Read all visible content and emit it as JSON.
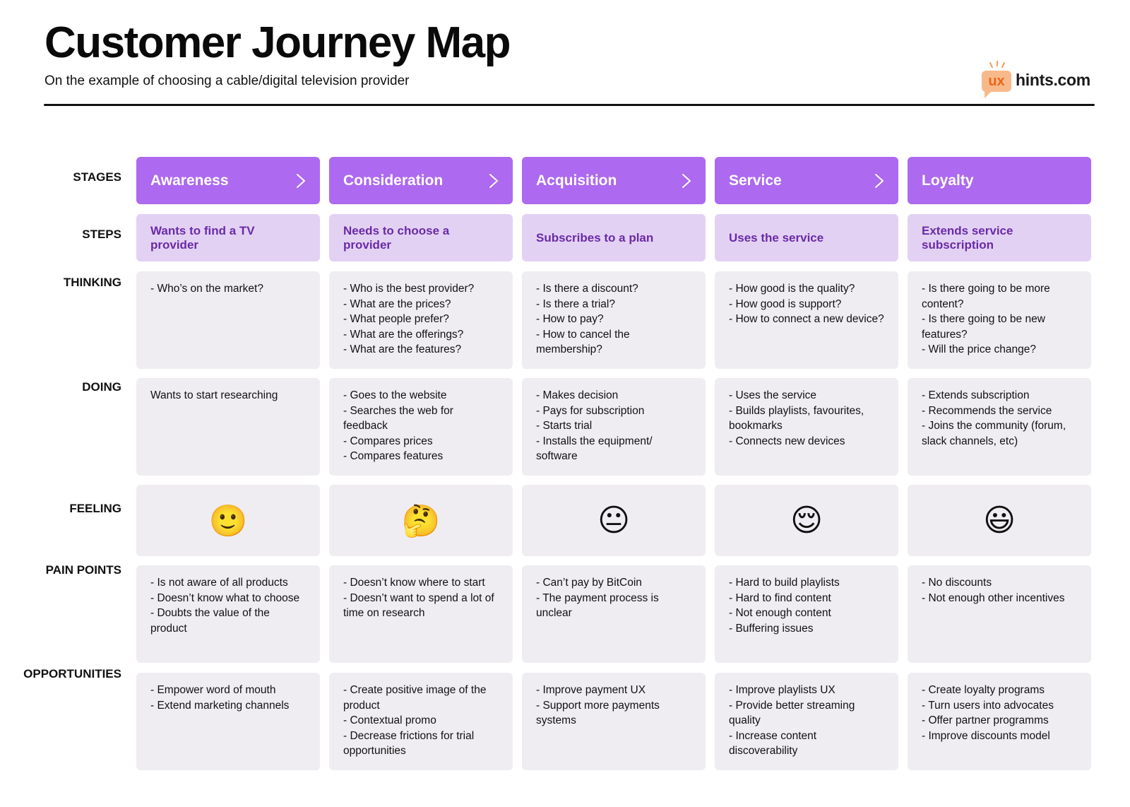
{
  "header": {
    "title": "Customer Journey Map",
    "subtitle": "On the example of choosing a cable/digital television provider"
  },
  "logo": {
    "badge": "ux",
    "text": "hints.com",
    "colors": {
      "badge_bg": "#f8b98a",
      "badge_text": "#e8671c"
    }
  },
  "row_labels": {
    "stages": "STAGES",
    "steps": "STEPS",
    "thinking": "THINKING",
    "doing": "DOING",
    "feeling": "FEELING",
    "pain_points": "PAIN POINTS",
    "opportunities": "OPPORTUNITIES"
  },
  "colors": {
    "stage_bg": "#ad69ef",
    "step_bg": "#e3d1f4",
    "step_text": "#6a2aa6",
    "card_bg": "#efedf2"
  },
  "columns": [
    {
      "stage": "Awareness",
      "has_chevron": true,
      "step": "Wants to find a TV provider",
      "thinking": "- Who’s on the market?",
      "doing": "Wants to start researching",
      "feeling": {
        "icon": "slightly-smiling-face-icon",
        "glyph": "🙂"
      },
      "pain_points": "- Is not aware of all products\n- Doesn’t know what to choose\n- Doubts the value of the product",
      "opportunities": "- Empower word of mouth\n- Extend marketing channels"
    },
    {
      "stage": "Consideration",
      "has_chevron": true,
      "step": "Needs to choose a provider",
      "thinking": "- Who is the best provider?\n- What are the prices?\n- What people prefer?\n- What are the offerings?\n- What are the features?",
      "doing": "- Goes to the website\n- Searches the web for feedback\n- Compares prices\n- Compares features",
      "feeling": {
        "icon": "thinking-face-icon",
        "glyph": "🤔"
      },
      "pain_points": "- Doesn’t know where to start\n- Doesn’t want to spend a lot of time on research",
      "opportunities": "- Create positive image of the product\n- Contextual promo\n- Decrease frictions for trial opportunities"
    },
    {
      "stage": "Acquisition",
      "has_chevron": true,
      "step": "Subscribes to a plan",
      "thinking": "- Is there a discount?\n- Is there a trial?\n- How to pay?\n- How to cancel the membership?",
      "doing": "- Makes decision\n- Pays for subscription\n- Starts trial\n- Installs the equipment/ software",
      "feeling": {
        "icon": "neutral-face-icon",
        "glyph": "😐"
      },
      "pain_points": "- Can’t pay by BitCoin\n- The payment process is unclear",
      "opportunities": "- Improve payment UX\n- Support more payments systems"
    },
    {
      "stage": "Service",
      "has_chevron": true,
      "step": "Uses the service",
      "thinking": "- How good is the quality?\n- How good is support?\n- How to connect a new device?",
      "doing": "- Uses the service\n- Builds playlists, favourites, bookmarks\n- Connects new devices",
      "feeling": {
        "icon": "relieved-face-icon",
        "glyph": "😌"
      },
      "pain_points": "- Hard to build playlists\n- Hard to find content\n- Not enough content\n- Buffering issues",
      "opportunities": "- Improve playlists UX\n- Provide better streaming quality\n- Increase content discoverability"
    },
    {
      "stage": "Loyalty",
      "has_chevron": false,
      "step": "Extends  service subscription",
      "thinking": "- Is there going to be more content?\n- Is there going to be new features?\n- Will the price change?",
      "doing": "- Extends subscription\n- Recommends the service\n- Joins the community (forum, slack channels, etc)",
      "feeling": {
        "icon": "grinning-face-icon",
        "glyph": "😃"
      },
      "pain_points": "- No discounts\n- Not enough other incentives",
      "opportunities": "- Create loyalty programs\n- Turn users into advocates\n- Offer partner programms\n- Improve discounts model"
    }
  ]
}
